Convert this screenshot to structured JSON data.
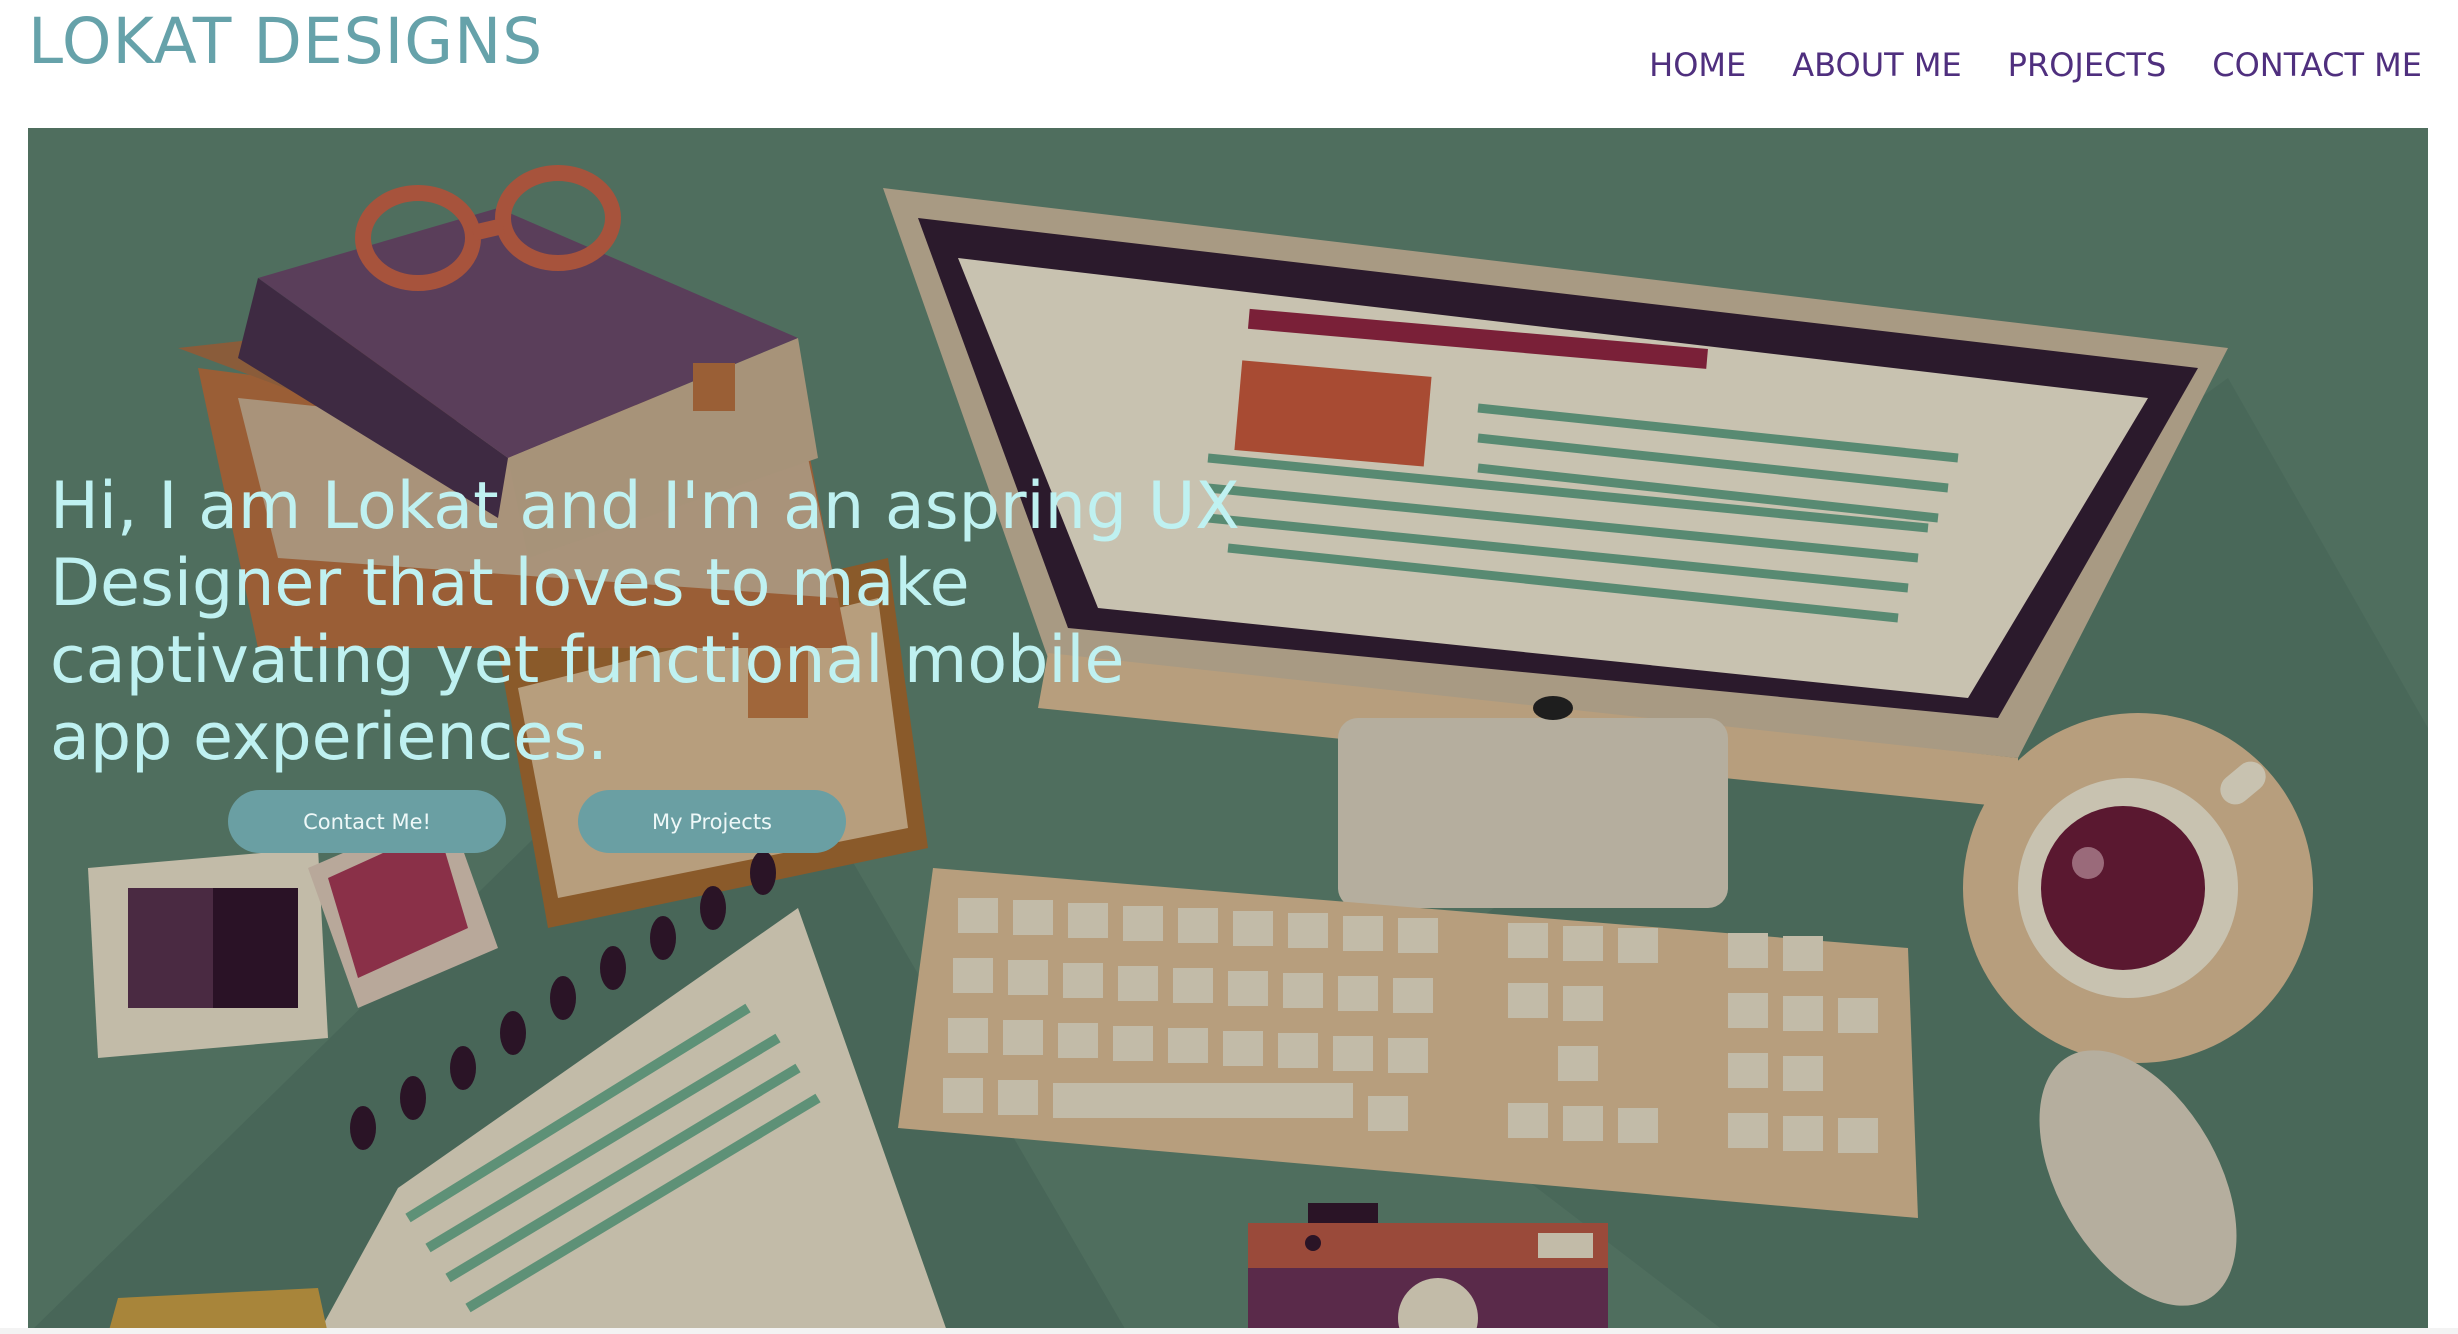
{
  "brand": "LOKAT DESIGNS",
  "nav": {
    "home": "HOME",
    "about": "ABOUT ME",
    "projects": "PROJECTS",
    "contact": "CONTACT ME"
  },
  "hero": {
    "headline": "Hi, I am Lokat and I'm an aspring UX Designer that loves to make captivating yet functional mobile app experiences.",
    "buttons": {
      "contact": "Contact Me!",
      "projects": "My Projects"
    }
  },
  "colors": {
    "brand": "#66a2aa",
    "nav": "#4f2f7e",
    "hero_bg": "#4f6e5e",
    "headline": "#bff1f1",
    "button": "#6a9fa3"
  },
  "icons": [
    "illustration-books",
    "illustration-glasses",
    "illustration-monitor",
    "illustration-keyboard",
    "illustration-coffee-cup",
    "illustration-mouse",
    "illustration-notepad",
    "illustration-photos",
    "illustration-camera"
  ]
}
